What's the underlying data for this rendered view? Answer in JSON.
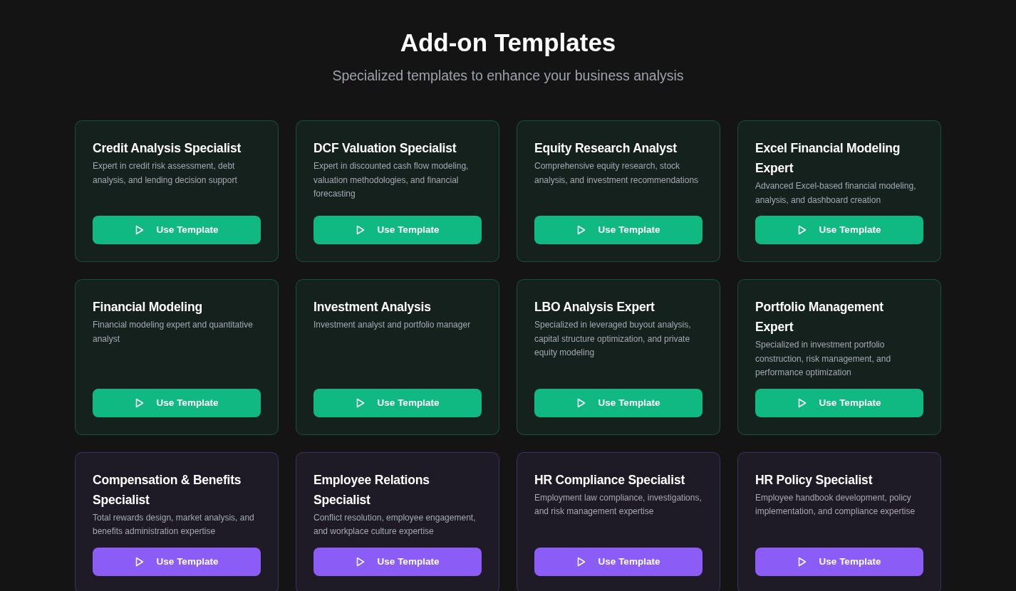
{
  "header": {
    "title": "Add-on Templates",
    "subtitle": "Specialized templates to enhance your business analysis"
  },
  "templates": [
    {
      "title": "Credit Analysis Specialist",
      "description": "Expert in credit risk assessment, debt analysis, and lending decision support",
      "button": "Use Template",
      "color": "#10b981"
    },
    {
      "title": "DCF Valuation Specialist",
      "description": "Expert in discounted cash flow modeling, valuation methodologies, and financial forecasting",
      "button": "Use Template",
      "color": "#10b981"
    },
    {
      "title": "Equity Research Analyst",
      "description": "Comprehensive equity research, stock analysis, and investment recommendations",
      "button": "Use Template",
      "color": "#10b981"
    },
    {
      "title": "Excel Financial Modeling Expert",
      "description": "Advanced Excel-based financial modeling, analysis, and dashboard creation",
      "button": "Use Template",
      "color": "#10b981"
    },
    {
      "title": "Financial Modeling",
      "description": "Financial modeling expert and quantitative analyst",
      "button": "Use Template",
      "color": "#10b981"
    },
    {
      "title": "Investment Analysis",
      "description": "Investment analyst and portfolio manager",
      "button": "Use Template",
      "color": "#10b981"
    },
    {
      "title": "LBO Analysis Expert",
      "description": "Specialized in leveraged buyout analysis, capital structure optimization, and private equity modeling",
      "button": "Use Template",
      "color": "#10b981"
    },
    {
      "title": "Portfolio Management Expert",
      "description": "Specialized in investment portfolio construction, risk management, and performance optimization",
      "button": "Use Template",
      "color": "#10b981"
    },
    {
      "title": "Compensation & Benefits Specialist",
      "description": "Total rewards design, market analysis, and benefits administration expertise",
      "button": "Use Template",
      "color": "#8b5cf6"
    },
    {
      "title": "Employee Relations Specialist",
      "description": "Conflict resolution, employee engagement, and workplace culture expertise",
      "button": "Use Template",
      "color": "#8b5cf6"
    },
    {
      "title": "HR Compliance Specialist",
      "description": "Employment law compliance, investigations, and risk management expertise",
      "button": "Use Template",
      "color": "#8b5cf6"
    },
    {
      "title": "HR Policy Specialist",
      "description": "Employee handbook development, policy implementation, and compliance expertise",
      "button": "Use Template",
      "color": "#8b5cf6"
    }
  ]
}
